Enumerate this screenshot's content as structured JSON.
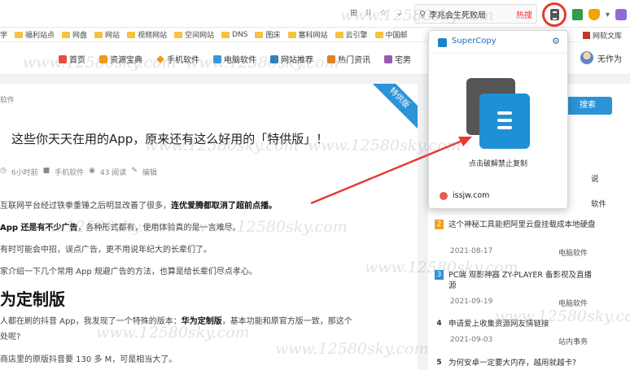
{
  "browser": {
    "toolbar_icons": [
      "⊞",
      "⁞⁞",
      "☆",
      "⌄"
    ],
    "search_query": "李兆会生死败局",
    "search_hot": "热搜",
    "ext_more": "▾"
  },
  "bookmarks": {
    "items": [
      "学",
      "福利站点",
      "网盘",
      "网站",
      "视频网站",
      "空间网站",
      "DNS",
      "图床",
      "塞科网站",
      "云引擎",
      "中国邮"
    ],
    "right_item": "网软文库"
  },
  "nav": {
    "items": [
      {
        "label": "首页",
        "color": "#e74c3c"
      },
      {
        "label": "资源宝典",
        "color": "#f39c12"
      },
      {
        "label": "手机软件",
        "color": "#f39c12"
      },
      {
        "label": "电脑软件",
        "color": "#3498db"
      },
      {
        "label": "网站推荐",
        "color": "#2980b9"
      },
      {
        "label": "热门资讯",
        "color": "#e67e22"
      },
      {
        "label": "宅男"
      }
    ],
    "user_name": "无作为"
  },
  "article": {
    "breadcrumb": "软件",
    "ribbon": "特供版",
    "title": "这些你天天在用的App，原来还有这么好用的「特供版」！",
    "meta_time": "6小时前",
    "meta_category": "手机软件",
    "meta_views": "43 阅读",
    "meta_edit": "编辑",
    "p1_pre": "互联网平台经过铁拳重锤之后明显改善了很多，",
    "p1_bold": "连优爱腾都取消了超前点播。",
    "p2_bold": "App 还是有不少广告",
    "p2_post": "，各种形式都有，使用体验真的是一言难尽。",
    "p3": "有时可能会中招，误点广告，更不用说年纪大的长辈们了。",
    "p4": "家介绍一下几个常用 App 规避广告的方法，也算是给长辈们尽点孝心。",
    "h2": "为定制版",
    "p5_pre": "人都在刷的抖音 App，我发现了一个特殊的版本：",
    "p5_bold": "华为定制版",
    "p5_post": "，基本功能和原官方版一致，那这个",
    "p6": "处呢?",
    "p7": "商店里的原版抖音要 130 多 M，可是相当大了。"
  },
  "sidebar": {
    "button": "搜索",
    "frag1": "说",
    "frag2": "软件",
    "ranks": [
      {
        "num": "2",
        "color": "#f0a020",
        "title": "这个神秘工具能把阿里云盘挂载成本地硬盘",
        "date": "2021-08-17",
        "category": "电脑软件"
      },
      {
        "num": "3",
        "color": "#2b93d6",
        "title": "PC端 观影神器 ZY-PLAYER 备影视及直播源",
        "date": "2021-09-19",
        "category": "电脑软件"
      },
      {
        "num": "4",
        "color": "",
        "title": "申请爱上收集资源网友情链接",
        "date": "2021-09-03",
        "category": "站内事务"
      },
      {
        "num": "5",
        "color": "",
        "title": "为何安卓一定要大内存，越用就越卡?"
      }
    ]
  },
  "popup": {
    "name": "SuperCopy",
    "label": "点击破解禁止复制",
    "site": "issjw.com"
  },
  "watermark": "www.12580sky.com",
  "colors": {
    "accent": "#2b93d6",
    "highlight_ring": "#e53935",
    "arrow": "#e53935"
  }
}
